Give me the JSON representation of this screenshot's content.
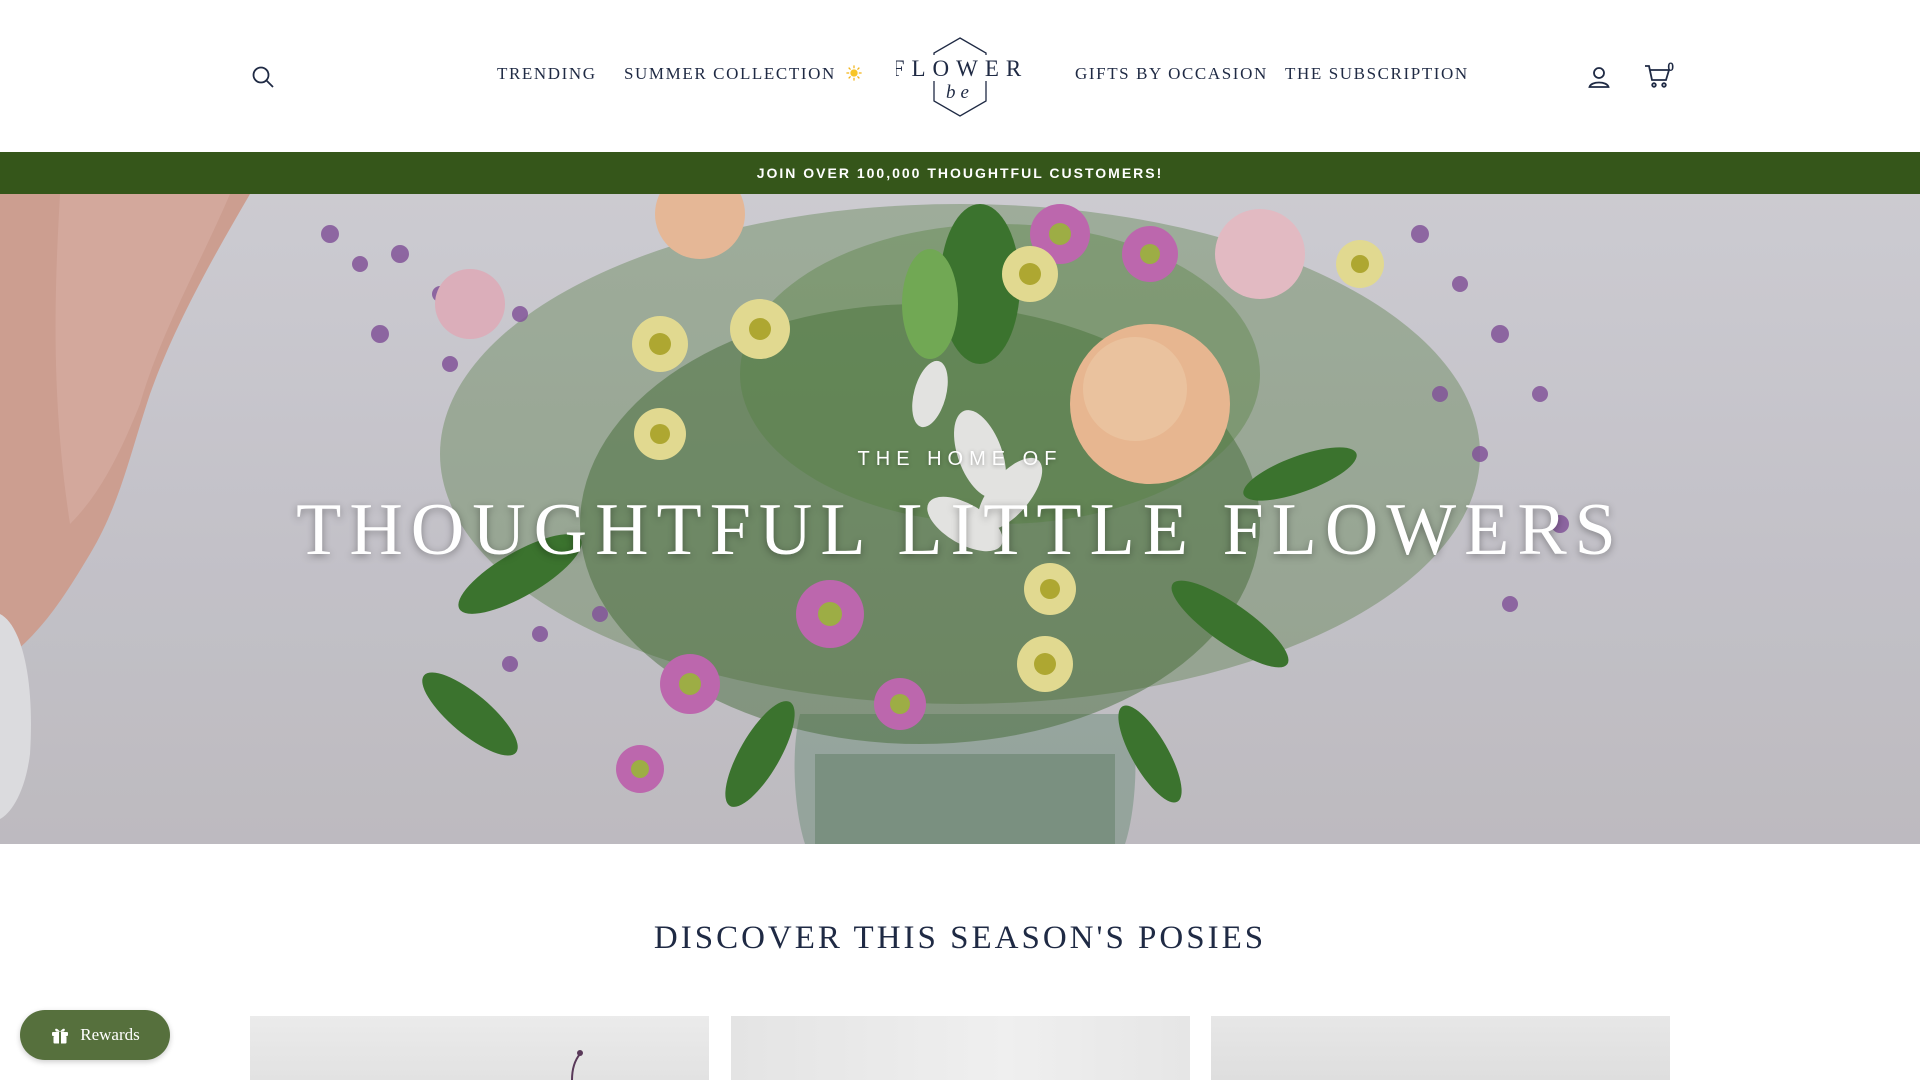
{
  "header": {
    "nav_left": [
      "TRENDING",
      "SUMMER COLLECTION"
    ],
    "nav_right": [
      "GIFTS BY OCCASION",
      "THE SUBSCRIPTION"
    ],
    "logo_top": "FLOWER",
    "logo_bottom": "be",
    "cart_count": "0",
    "icons": [
      "search-icon",
      "account-icon",
      "cart-icon",
      "sun-icon"
    ]
  },
  "announcement": "JOIN OVER 100,000 THOUGHTFUL CUSTOMERS!",
  "hero": {
    "overline": "THE HOME OF",
    "title": "THOUGHTFUL LITTLE FLOWERS"
  },
  "section": {
    "title": "DISCOVER THIS SEASON'S POSIES"
  },
  "rewards": {
    "label": "Rewards"
  },
  "colors": {
    "brand_green": "#35561a",
    "rewards_green": "#56703d",
    "navy_text": "#1f2a44"
  }
}
